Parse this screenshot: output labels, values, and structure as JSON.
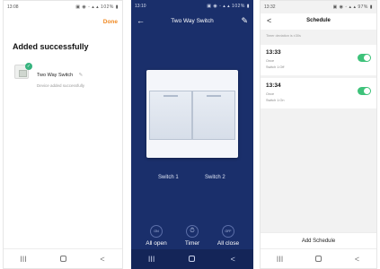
{
  "panel1": {
    "status": {
      "time": "13:08",
      "icons": "▣ ◉ ◦ ▴ ▴ 102% ▮"
    },
    "done_label": "Done",
    "title": "Added successfully",
    "device": {
      "name": "Two Way Switch",
      "status": "Device added successfully"
    },
    "nav": {
      "recents": "III",
      "home": "",
      "back": "<"
    }
  },
  "panel2": {
    "status": {
      "time": "13:10",
      "icons": "▣ ◉ ◦ ▴ ▴ 102% ▮"
    },
    "back_icon": "arrow-left",
    "title": "Two Way Switch",
    "edit_icon": "pencil",
    "switches": [
      "Switch 1",
      "Switch 2"
    ],
    "controls": [
      {
        "icon_text": "ON",
        "label": "All open"
      },
      {
        "icon_text": "",
        "label": "Timer"
      },
      {
        "icon_text": "OFF",
        "label": "All close"
      }
    ],
    "nav": {
      "recents": "III",
      "home": "",
      "back": "<"
    }
  },
  "panel3": {
    "status": {
      "time": "13:32",
      "icons": "▣ ◉ ◦ ▴ ▴ 97% ▮"
    },
    "title": "Schedule",
    "timezone_note": "Timer deviation is ±30s",
    "schedules": [
      {
        "time": "13:33",
        "repeat": "Once",
        "action": "Switch 1:Off",
        "enabled": true
      },
      {
        "time": "13:34",
        "repeat": "Once",
        "action": "Switch 1:On",
        "enabled": true
      }
    ],
    "add_label": "Add Schedule",
    "nav": {
      "recents": "III",
      "home": "",
      "back": "<"
    }
  },
  "colors": {
    "accent_orange": "#f08a24",
    "switch_bg": "#1a2f6b",
    "toggle_on": "#3ec27a",
    "success_badge": "#36b37e"
  }
}
